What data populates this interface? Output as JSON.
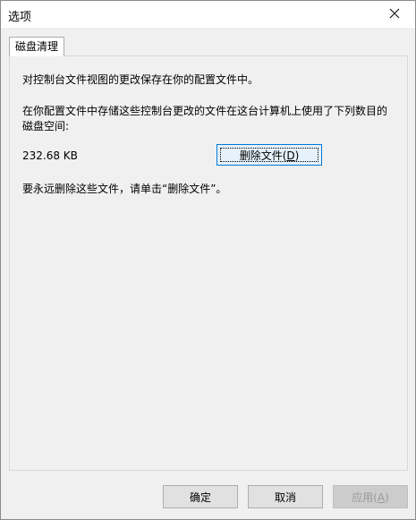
{
  "window": {
    "title": "选项"
  },
  "tabs": [
    {
      "label": "磁盘清理"
    }
  ],
  "panel": {
    "intro": "对控制台文件视图的更改保存在你的配置文件中。",
    "usage_line1": "在你配置文件中存储这些控制台更改的文件在这台计算机上使用了下列数目的",
    "usage_line2": "磁盘空间:",
    "size_value": "232.68 KB",
    "delete_button": {
      "label": "删除文件(",
      "accel": "D",
      "suffix": ")"
    },
    "hint": "要永远删除这些文件，请单击“删除文件”。"
  },
  "footer": {
    "ok_label": "确定",
    "cancel_label": "取消",
    "apply": {
      "label": "应用(",
      "accel": "A",
      "suffix": ")"
    }
  },
  "icons": {
    "close": "close-icon"
  }
}
